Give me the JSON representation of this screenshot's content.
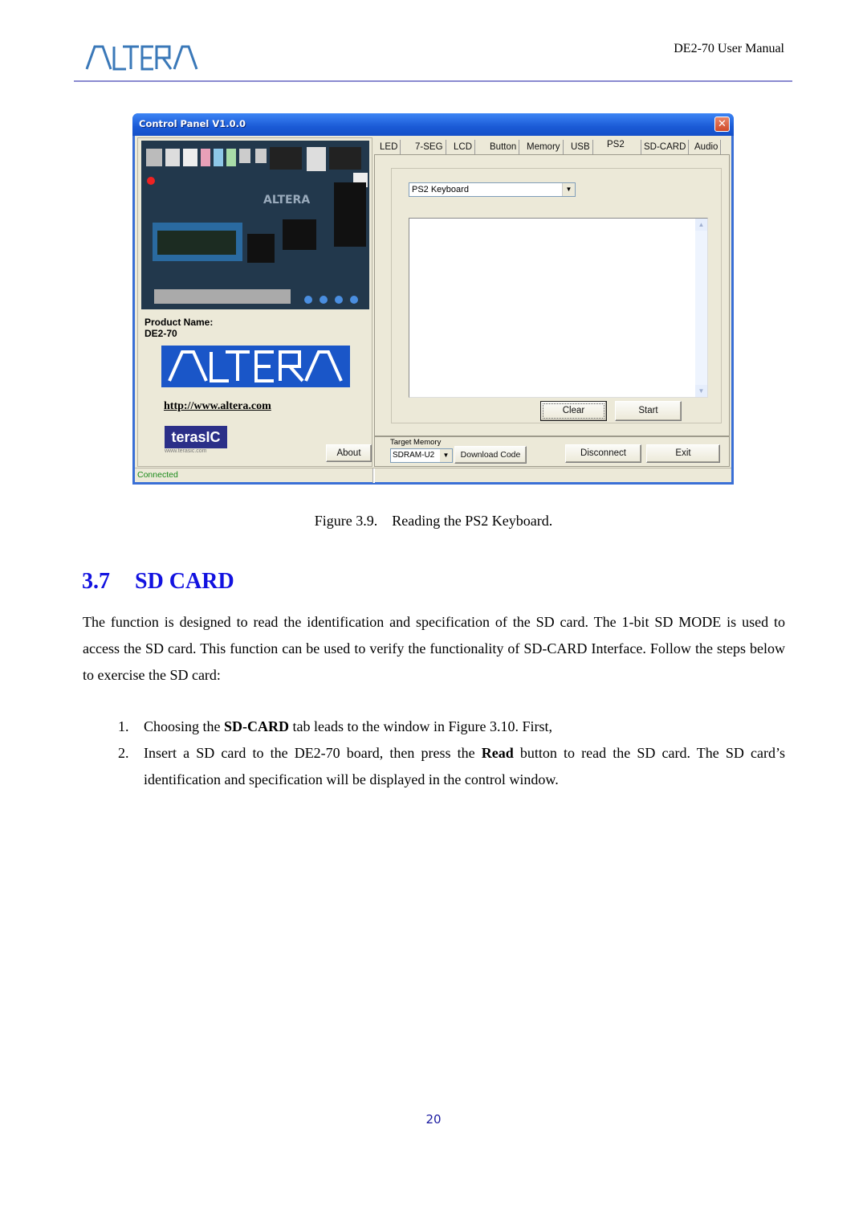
{
  "header": {
    "logo_text": "ALTERA",
    "doc_title": "DE2-70 User Manual"
  },
  "window": {
    "title": "Control Panel V1.0.0",
    "close_icon": "close-icon",
    "left_panel": {
      "product_label": "Product Name:",
      "product_value": "DE2-70",
      "banner_text": "ALTERA",
      "url": "http://www.altera.com",
      "terasic_logo": "terasIC",
      "terasic_url": "www.terasic.com",
      "about_label": "About"
    },
    "tabs": [
      {
        "label": "LED",
        "active": false
      },
      {
        "label": "7-SEG",
        "active": false
      },
      {
        "label": "LCD",
        "active": false
      },
      {
        "label": "Button",
        "active": false
      },
      {
        "label": "Memory",
        "active": false
      },
      {
        "label": "USB",
        "active": false
      },
      {
        "label": "PS2",
        "active": true
      },
      {
        "label": "SD-CARD",
        "active": false
      },
      {
        "label": "Audio",
        "active": false
      }
    ],
    "ps2": {
      "mode_selected": "PS2 Keyboard",
      "output_text": "",
      "clear_label": "Clear",
      "start_label": "Start"
    },
    "bottom": {
      "target_memory_label": "Target Memory",
      "target_memory_value": "SDRAM-U2",
      "download_label": "Download Code",
      "disconnect_label": "Disconnect",
      "exit_label": "Exit"
    },
    "status": "Connected"
  },
  "caption": "Figure 3.9.    Reading the PS2 Keyboard.",
  "section": {
    "number": "3.7",
    "title": "SD CARD",
    "paragraph": "The function is designed to read the identification and specification of the SD card. The 1-bit SD MODE is used to access the SD card. This function can be used to verify the functionality of SD-CARD Interface. Follow the steps below to exercise the SD card:",
    "steps": [
      {
        "num": "1.",
        "pre": "Choosing the ",
        "bold": "SD-CARD",
        "post": " tab leads to the window in Figure 3.10. First,"
      },
      {
        "num": "2.",
        "pre": "Insert a SD card to the DE2-70 board, then press the ",
        "bold": "Read",
        "post": " button to read the SD card. The SD card’s identification and specification will be displayed in the control window."
      }
    ]
  },
  "page_number": "20"
}
